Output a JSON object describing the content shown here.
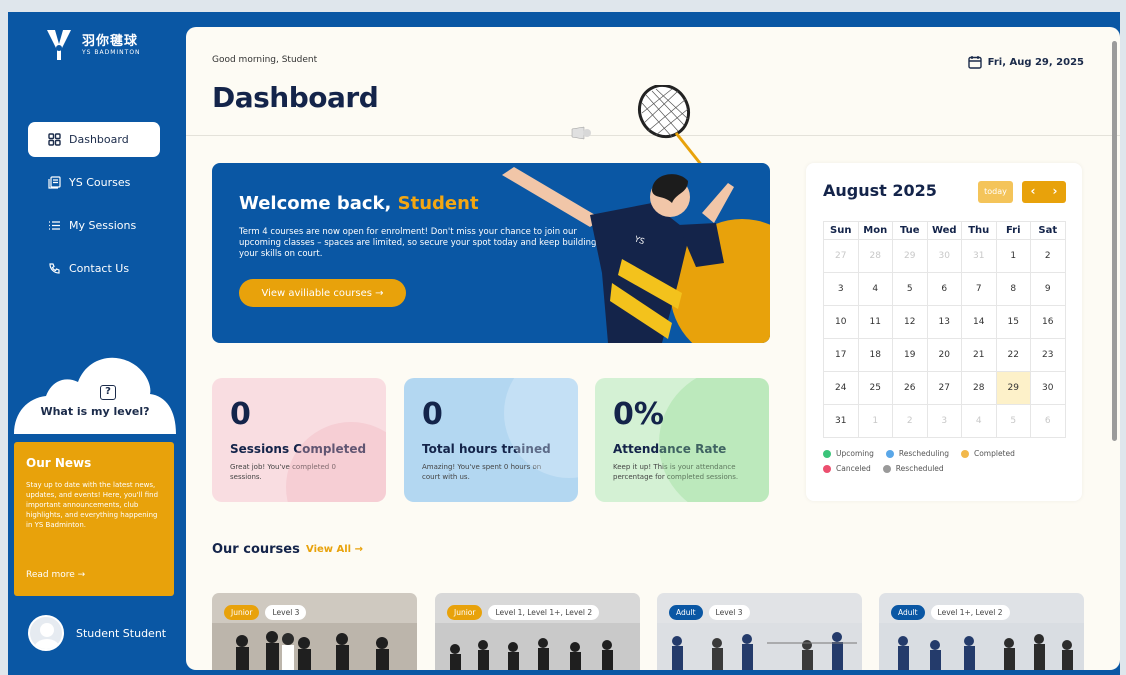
{
  "brand": {
    "name_cn": "羽你毽球",
    "name_en": "YS BADMINTON"
  },
  "nav": [
    {
      "label": "Dashboard",
      "icon": "grid-icon",
      "active": true
    },
    {
      "label": "YS Courses",
      "icon": "courses-icon",
      "active": false
    },
    {
      "label": "My Sessions",
      "icon": "list-icon",
      "active": false
    },
    {
      "label": "Contact Us",
      "icon": "contact-icon",
      "active": false
    }
  ],
  "level": {
    "question": "What is my level?"
  },
  "news": {
    "title": "Our News",
    "body": "Stay up to date with the latest news, updates, and events! Here, you'll find important announcements, club highlights, and everything happening in YS Badminton.",
    "link": "Read more →"
  },
  "user": {
    "name": "Student Student"
  },
  "header": {
    "greeting": "Good morning, Student",
    "title": "Dashboard",
    "date": "Fri, Aug 29, 2025"
  },
  "banner": {
    "title_prefix": "Welcome back,",
    "title_name": "Student",
    "text": "Term 4 courses are now open for enrolment! Don't miss your chance to join our upcoming classes – spaces are limited, so secure your spot today and keep building your skills on court.",
    "button": "View aviliable courses →"
  },
  "stats": [
    {
      "value": "0",
      "label": "Sessions Completed",
      "desc": "Great job! You've completed 0 sessions."
    },
    {
      "value": "0",
      "label": "Total hours trained",
      "desc": "Amazing! You've spent 0 hours on court with us."
    },
    {
      "value": "0%",
      "label": "Attendance Rate",
      "desc": "Keep it up! This is your attendance percentage for completed sessions."
    }
  ],
  "calendar": {
    "month": "August 2025",
    "today_label": "today",
    "prev": "‹",
    "next": "›",
    "weekdays": [
      "Sun",
      "Mon",
      "Tue",
      "Wed",
      "Thu",
      "Fri",
      "Sat"
    ],
    "weeks": [
      [
        "27",
        "28",
        "29",
        "30",
        "31",
        "1",
        "2"
      ],
      [
        "3",
        "4",
        "5",
        "6",
        "7",
        "8",
        "9"
      ],
      [
        "10",
        "11",
        "12",
        "13",
        "14",
        "15",
        "16"
      ],
      [
        "17",
        "18",
        "19",
        "20",
        "21",
        "22",
        "23"
      ],
      [
        "24",
        "25",
        "26",
        "27",
        "28",
        "29",
        "30"
      ],
      [
        "31",
        "1",
        "2",
        "3",
        "4",
        "5",
        "6"
      ]
    ],
    "legend": [
      {
        "label": "Upcoming",
        "color": "#3bc47a"
      },
      {
        "label": "Rescheduling",
        "color": "#5aa7e8"
      },
      {
        "label": "Completed",
        "color": "#f2b84b"
      },
      {
        "label": "Canceled",
        "color": "#ec4f6f"
      },
      {
        "label": "Rescheduled",
        "color": "#9a9a9a"
      }
    ]
  },
  "courses": {
    "title": "Our courses",
    "view_all": "View All →",
    "items": [
      {
        "tag": "Junior",
        "level": "Level 3"
      },
      {
        "tag": "Junior",
        "level": "Level 1, Level 1+, Level 2"
      },
      {
        "tag": "Adult",
        "level": "Level 3"
      },
      {
        "tag": "Adult",
        "level": "Level 1+, Level 2"
      }
    ]
  },
  "colors": {
    "primary": "#0a57a4",
    "accent": "#e8a20b",
    "navy": "#14244a"
  }
}
